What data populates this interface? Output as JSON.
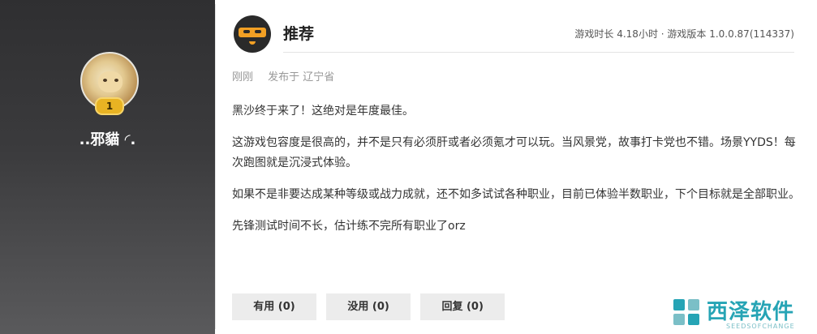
{
  "user": {
    "name": "..邪貓 ◜.",
    "level": "1"
  },
  "review": {
    "title": "推荐",
    "meta": "游戏时长 4.18小时 · 游戏版本 1.0.0.87(114337)",
    "time": "刚刚",
    "location": "发布于 辽宁省",
    "paragraphs": [
      "黑沙终于来了！这绝对是年度最佳。",
      "这游戏包容度是很高的，并不是只有必须肝或者必须氪才可以玩。当风景党，故事打卡党也不错。场景YYDS！每次跑图就是沉浸式体验。",
      "如果不是非要达成某种等级或战力成就，还不如多试试各种职业，目前已体验半数职业，下个目标就是全部职业。",
      "先锋测试时间不长，估计练不完所有职业了orz"
    ]
  },
  "actions": {
    "useful": "有用 (0)",
    "useless": "没用 (0)",
    "reply": "回复 (0)"
  },
  "watermark": {
    "name": "西泽软件",
    "sub": "SEEDSOFCHANGE"
  },
  "colors": {
    "accent_orange": "#f2a024",
    "badge_gold": "#e8b323",
    "watermark_teal": "#26a4b5"
  }
}
